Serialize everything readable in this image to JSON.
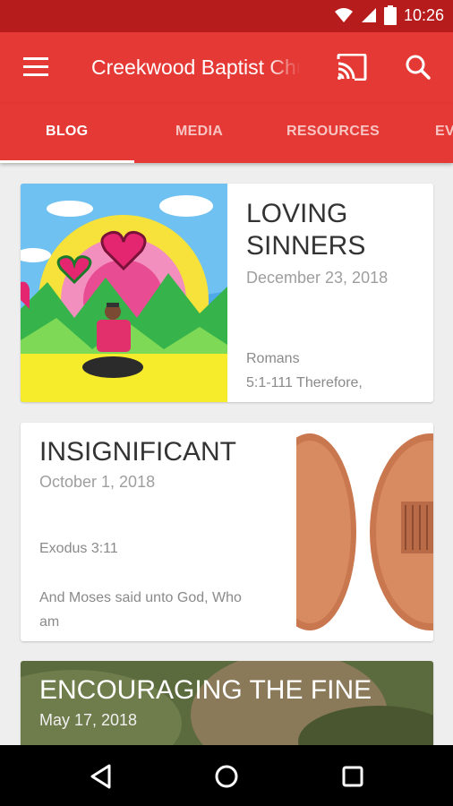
{
  "status_bar": {
    "time": "10:26",
    "icons": [
      "wifi-icon",
      "signal-icon",
      "battery-icon"
    ]
  },
  "app_bar": {
    "title": "Creekwood Baptist Church",
    "icons": [
      "menu-icon",
      "cast-icon",
      "search-icon"
    ]
  },
  "tabs": [
    {
      "label": "BLOG",
      "active": true
    },
    {
      "label": "MEDIA",
      "active": false
    },
    {
      "label": "RESOURCES",
      "active": false
    },
    {
      "label": "EVENTS",
      "active": false
    }
  ],
  "posts": [
    {
      "title_line1": "LOVING",
      "title_line2": "SINNERS",
      "date": "December 23, 2018",
      "excerpt_line1": "Romans",
      "excerpt_line2": "5:1-111 Therefore,"
    },
    {
      "title": "INSIGNIFICANT",
      "date": "October 1, 2018",
      "verse": "Exodus 3:11",
      "excerpt_line1": "And Moses said unto God, Who",
      "excerpt_line2": "am"
    },
    {
      "title": "ENCOURAGING THE FINE",
      "date": "May 17, 2018"
    }
  ],
  "colors": {
    "primary": "#e53935",
    "primary_dark": "#b71c1c",
    "background": "#eeeeee"
  },
  "nav_bar": {
    "icons": [
      "back-icon",
      "home-icon",
      "recents-icon"
    ]
  }
}
